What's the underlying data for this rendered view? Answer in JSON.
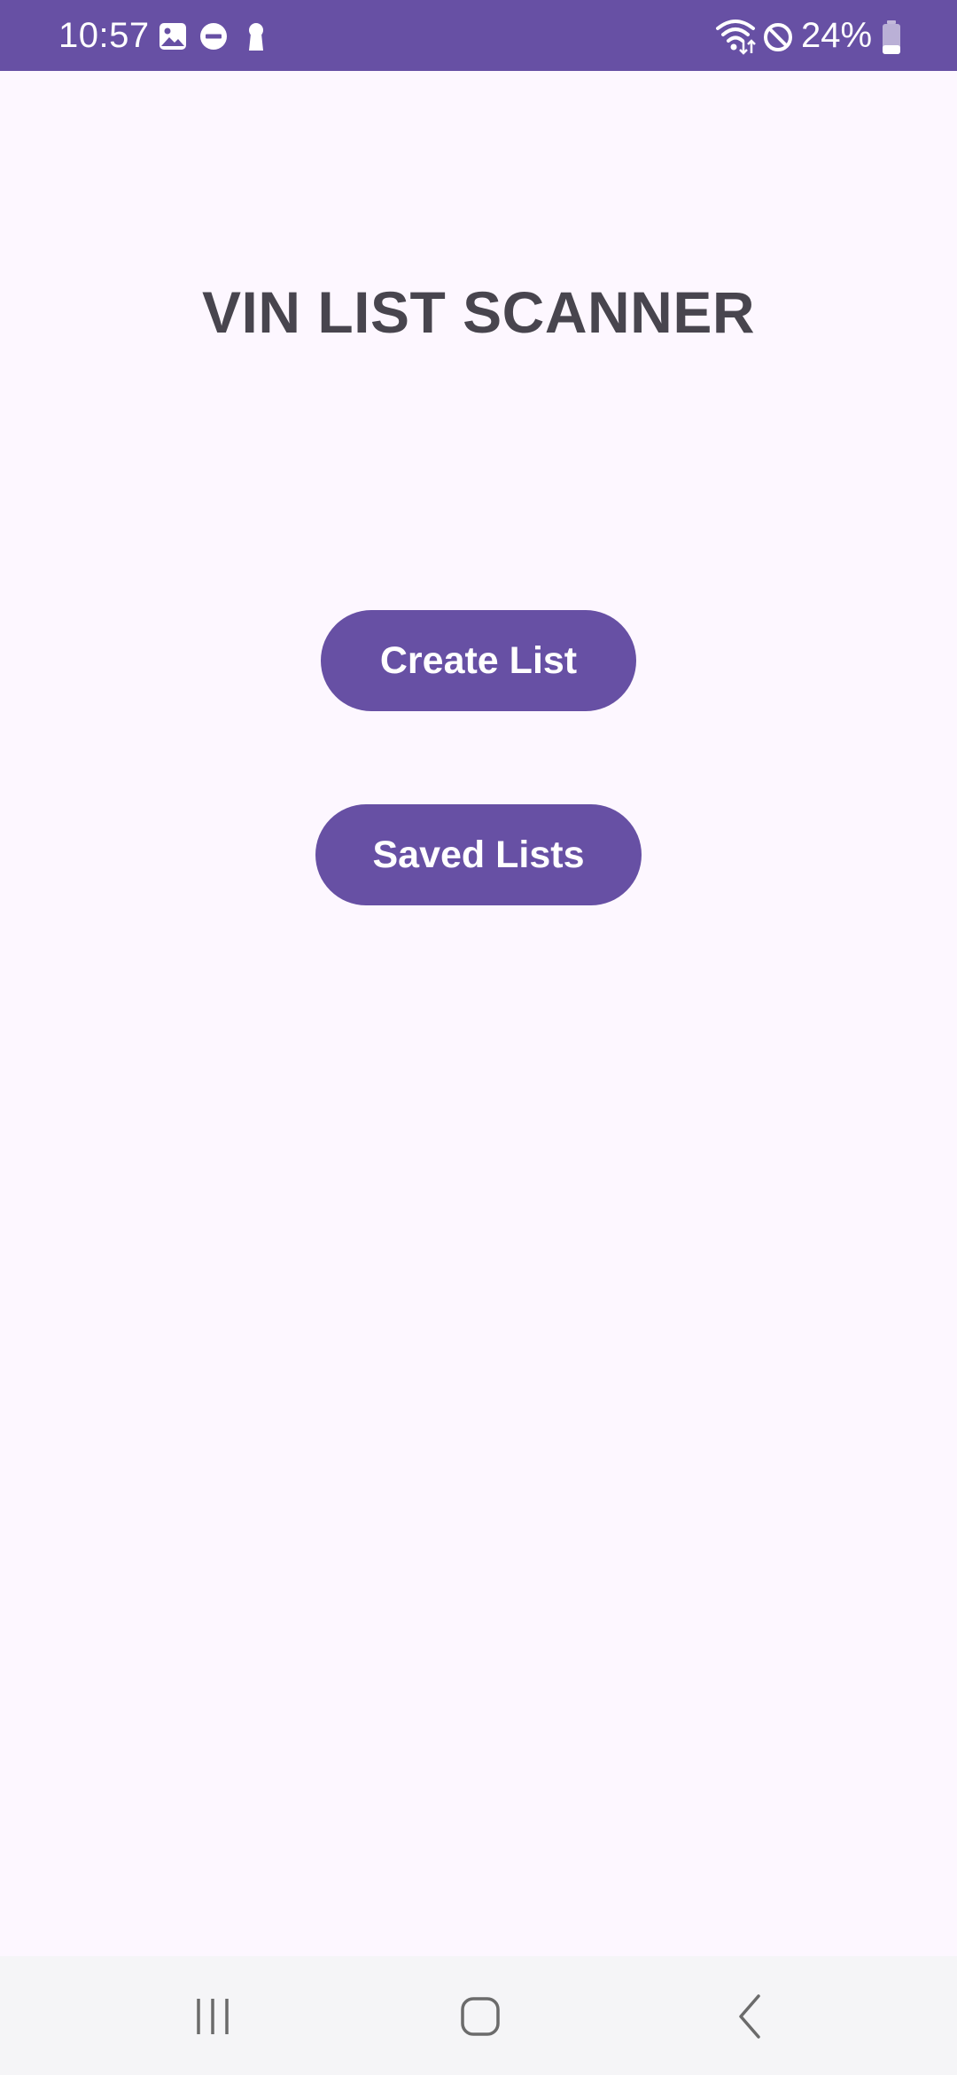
{
  "status_bar": {
    "time": "10:57",
    "battery_percent": "24%",
    "icons_left": [
      "gallery-icon",
      "do-not-disturb-icon",
      "keyhole-icon"
    ],
    "icons_right": [
      "wifi-icon",
      "blocked-icon",
      "battery-icon"
    ],
    "battery_level": 0.24
  },
  "app": {
    "title": "VIN LIST SCANNER",
    "create_list_label": "Create List",
    "saved_lists_label": "Saved Lists"
  },
  "nav": {
    "icons": [
      "recent-apps-icon",
      "home-icon",
      "back-icon"
    ]
  },
  "colors": {
    "primary": "#6750a4",
    "background": "#fdf7ff",
    "title_text": "#48454e",
    "nav_background": "#f5f5f7",
    "nav_icon": "#6b6b6b"
  }
}
